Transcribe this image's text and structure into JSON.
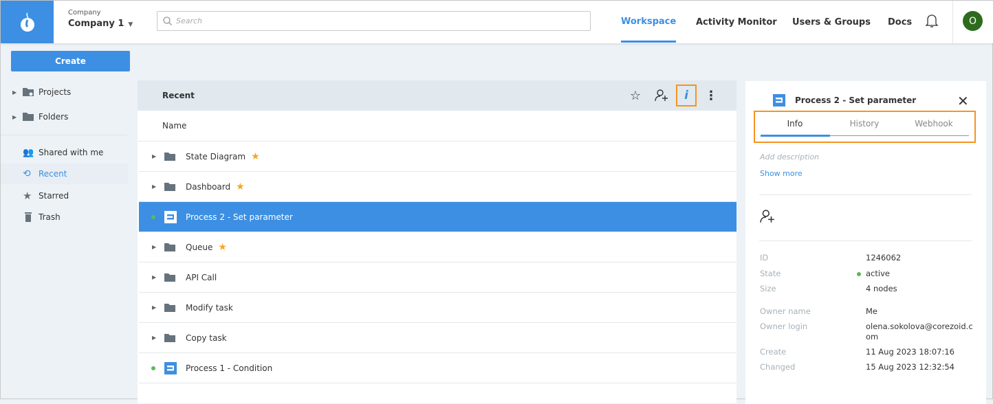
{
  "header": {
    "company_label": "Company",
    "company_name": "Company 1",
    "search_placeholder": "Search",
    "nav": [
      "Workspace",
      "Activity Monitor",
      "Users & Groups",
      "Docs"
    ],
    "avatar": "O"
  },
  "sidebar": {
    "create": "Create",
    "tree": [
      "Projects",
      "Folders"
    ],
    "items": [
      "Shared with me",
      "Recent",
      "Starred",
      "Trash"
    ]
  },
  "main": {
    "title": "Recent",
    "column": "Name",
    "rows": [
      {
        "name": "State Diagram",
        "type": "folder",
        "starred": true
      },
      {
        "name": "Dashboard",
        "type": "folder",
        "starred": true
      },
      {
        "name": "Process 2 - Set parameter",
        "type": "process",
        "selected": true
      },
      {
        "name": "Queue",
        "type": "folder",
        "starred": true
      },
      {
        "name": "API Call",
        "type": "folder"
      },
      {
        "name": "Modify task",
        "type": "folder"
      },
      {
        "name": "Copy task",
        "type": "folder"
      },
      {
        "name": "Process 1 - Condition",
        "type": "process"
      }
    ]
  },
  "panel": {
    "title": "Process 2 - Set parameter",
    "tabs": [
      "Info",
      "History",
      "Webhook"
    ],
    "description_placeholder": "Add description",
    "show_more": "Show more",
    "fields": [
      {
        "k": "ID",
        "v": "1246062"
      },
      {
        "k": "State",
        "v": "active"
      },
      {
        "k": "Size",
        "v": "4  nodes"
      },
      {
        "k": "Owner name",
        "v": "Me"
      },
      {
        "k": "Owner login",
        "v": "olena.sokolova@corezoid.com"
      },
      {
        "k": "Create",
        "v": "11 Aug 2023 18:07:16"
      },
      {
        "k": "Changed",
        "v": "15 Aug 2023 12:32:54"
      }
    ]
  },
  "colors": {
    "accent": "#3c8fe3",
    "highlight": "#f7931e",
    "star": "#f5a623",
    "active": "#5cb85c",
    "avatar": "#2e6b1f"
  }
}
